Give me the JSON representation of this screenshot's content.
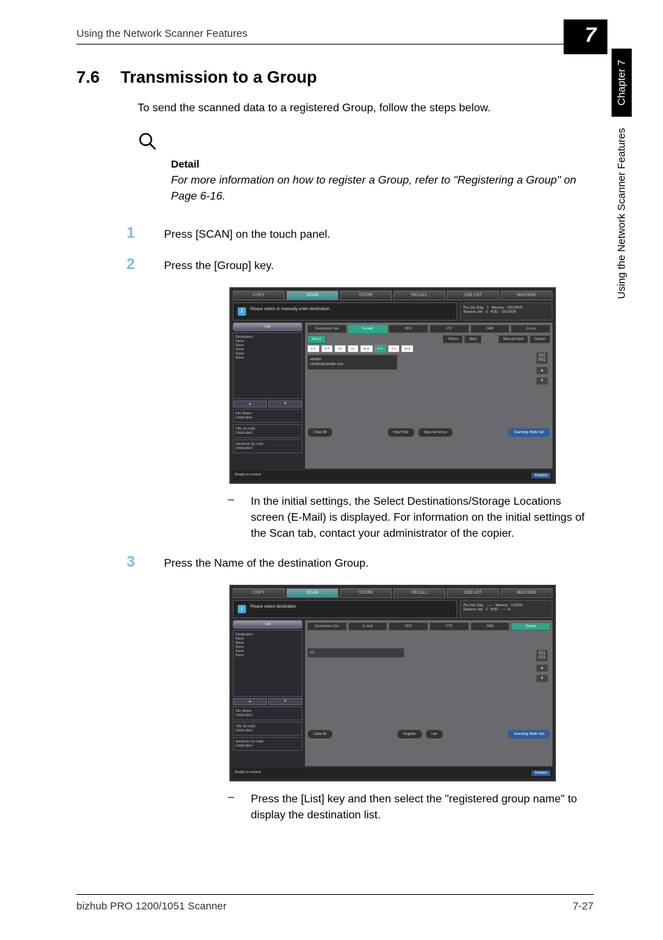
{
  "header": {
    "title": "Using the Network Scanner Features"
  },
  "chapter": {
    "num": "7",
    "tab": "Chapter 7",
    "side": "Using the Network Scanner Features"
  },
  "section": {
    "num": "7.6",
    "title": "Transmission to a Group",
    "intro": "To send the scanned data to a registered Group, follow the steps below."
  },
  "detail": {
    "title": "Detail",
    "text": "For more information on how to register a Group, refer to \"Registering a Group\" on Page 6-16."
  },
  "steps": {
    "s1": {
      "num": "1",
      "text": "Press [SCAN] on the touch panel."
    },
    "s2": {
      "num": "2",
      "text": "Press the [Group] key."
    },
    "s3": {
      "num": "3",
      "text": "Press the Name of the destination Group."
    }
  },
  "note1": "In the initial settings, the Select Destinations/Storage Locations screen (E-Mail) is displayed. For information on the initial settings of the Scan tab, contact your administrator of the copier.",
  "note2": "Press the [List] key and then select the \"registered group name\" to display the destination list.",
  "dash": "–",
  "shot1": {
    "tabs": {
      "copy": "COPY",
      "scan": "SCAN",
      "store": "STORE",
      "recall": "RECALL",
      "joblist": "JOB LIST",
      "machine": "MACHINE"
    },
    "msg": "Please select or manually enter destination",
    "status": {
      "l1": "Pre-Job Orig.",
      "l1v": "1",
      "l2": "Reserve Job",
      "l2v": "0",
      "mem": "Memory",
      "hdd": "HDD",
      "pct": "100.000%"
    },
    "left": {
      "list": "List",
      "dest": "Destination",
      "none": "None",
      "file": "File Name",
      "und": "Undecided",
      "title": "Title (E-mail)",
      "sent": "Sentence (E-mail)"
    },
    "proto": {
      "set": "Destination Set",
      "email": "E-mail",
      "hdd": "HDD",
      "ftp": "FTP",
      "smb": "SMB",
      "group": "Group"
    },
    "filter": {
      "atoz": "A to Z",
      "others": "Others",
      "main": "Main",
      "manual": "Manual Input",
      "search": "Search"
    },
    "alpha": {
      "a": "A-C",
      "b": "D-F",
      "c": "G-I",
      "d": "J-L",
      "e": "M-O",
      "f": "P-S",
      "g": "T-V",
      "h": "W-Z"
    },
    "entry": {
      "name": "sample",
      "addr": "sample@sample.com"
    },
    "pager": {
      "count": "001\n001",
      "up": "▲",
      "down": "▼"
    },
    "bottom": {
      "clear": "Clear All",
      "inptitle": "Input Title",
      "inpsent": "Input Sentence",
      "mode": "Scanning Mode Set"
    },
    "statusbar": {
      "ready": "Ready to receive",
      "rot": "Rotation"
    }
  },
  "shot2": {
    "msg": "Please select destination",
    "status": {
      "l1": "Pre-Job Orig.",
      "l1v": "-----",
      "l2": "Reserve Job",
      "l2v": "0",
      "mem": "Memory",
      "hdd": "HDD",
      "pct1": "0.000%",
      "pct2": "----- %"
    },
    "entry": "G1",
    "bottom": {
      "clear": "Clear All",
      "register": "Register",
      "list": "List",
      "mode": "Scanning Mode Set"
    }
  },
  "footer": {
    "model": "bizhub PRO 1200/1051 Scanner",
    "page": "7-27"
  }
}
